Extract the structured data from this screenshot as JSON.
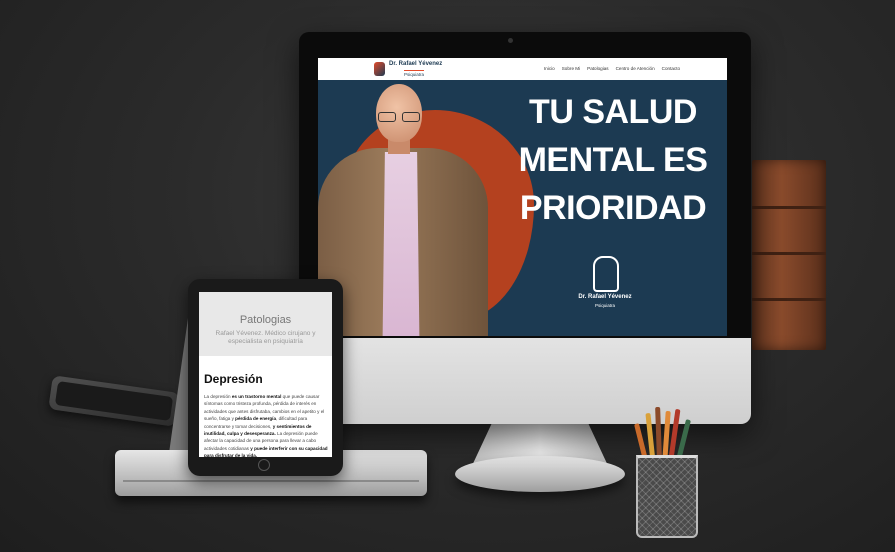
{
  "website": {
    "brand": {
      "name": "Dr. Rafael Yévenez",
      "subtitle": "Psiquiatra"
    },
    "nav": [
      "Inicio",
      "Sobre Mi",
      "Patologias",
      "Centro de Atención",
      "Contacto"
    ],
    "hero": {
      "headline_line1": "TU SALUD",
      "headline_line2": "MENTAL ES",
      "headline_line3": "PRIORIDAD",
      "logo_name": "Dr. Rafael Yévenez",
      "logo_subtitle": "Psiquiatra"
    }
  },
  "tablet": {
    "title": "Patologias",
    "subtitle": "Rafael Yévenez. Médico cirujano y especialista en psiquiatría",
    "heading": "Depresión",
    "body_1": "La depresión ",
    "body_2": "es un trastorno mental",
    "body_3": " que puede causar síntomas como tristeza profunda, pérdida de interés en actividades que antes disfrutaba, cambios en el apetito y el sueño, fatiga y ",
    "body_4": "pérdida de energía",
    "body_5": ", dificultad para concentrarse y tomar decisiones, ",
    "body_6": "y sentimientos de inutilidad, culpa y desesperanza.",
    "body_7": " La depresión puede afectar la capacidad de una persona para llevar a cabo actividades cotidianas ",
    "body_8": "y puede interferir con su capacidad para disfrutar de la vida."
  },
  "colors": {
    "hero_bg": "#1c3a52",
    "blob_red": "#b4411f",
    "blob_orange": "#e0962a",
    "accent": "#e34a2a"
  }
}
